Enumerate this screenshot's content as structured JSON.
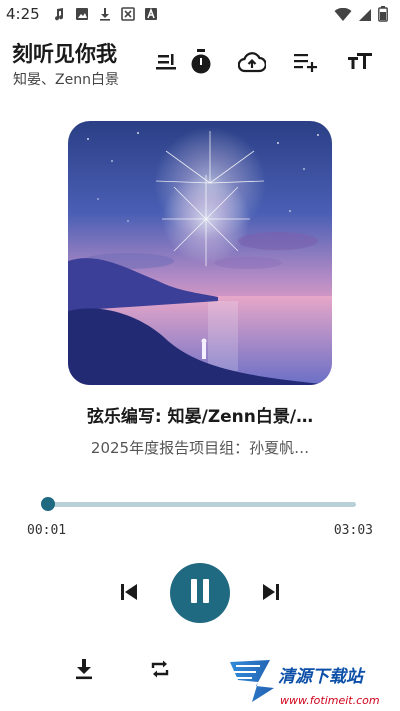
{
  "status": {
    "time": "4:25",
    "notification_icons": [
      "music-note-icon",
      "image-icon",
      "download-icon",
      "no-sim-icon",
      "a-box-icon"
    ],
    "right_icons": [
      "wifi-icon",
      "signal-icon",
      "battery-icon"
    ]
  },
  "header": {
    "title": "刻听见你我",
    "artist": "知晏、Zenn白景",
    "icons": [
      "lyrics-icon",
      "timer-icon",
      "cloud-upload-icon",
      "add-to-playlist-icon",
      "text-size-icon"
    ]
  },
  "track": {
    "line1": "弦乐编写: 知晏/Zenn白景/…",
    "line2": "2025年度报告项目组：孙夏帆…"
  },
  "progress": {
    "current": "00:01",
    "total": "03:03",
    "fraction": 0.005
  },
  "controls": [
    "previous-icon",
    "pause-icon",
    "next-icon"
  ],
  "bottom": {
    "icons": [
      "download-icon",
      "repeat-icon"
    ],
    "watermark_text": "清源下载站",
    "watermark_url": "www.fotimeit.com"
  },
  "colors": {
    "accent": "#1f6a80",
    "track_bg": "#b9d0d8"
  }
}
